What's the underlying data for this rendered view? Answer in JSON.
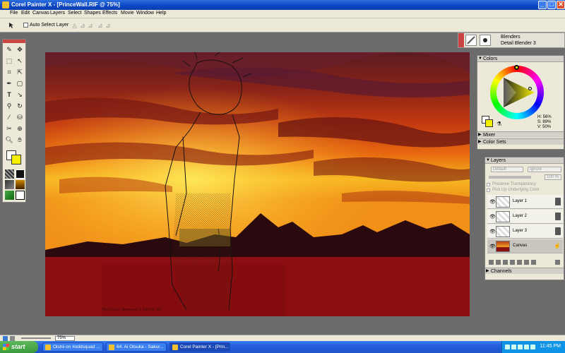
{
  "window": {
    "title": "Corel Painter X - [PrinceWall.RIF @ 75%]",
    "minimize": "_",
    "maximize": "□",
    "close": "✕"
  },
  "menu": [
    "File",
    "Edit",
    "Canvas",
    "Layers",
    "Select",
    "Shapes",
    "Effects",
    "Movie",
    "Window",
    "Help"
  ],
  "property_bar": {
    "auto_select_label": "Auto Select Layer",
    "auto_select_checked": false,
    "icons": [
      "arrow-pointer-icon",
      "align-icon",
      "transform-icon",
      "transform-icon",
      "transform-icon"
    ]
  },
  "brush_selector": {
    "category": "Blenders",
    "variant": "Detail Blender 3"
  },
  "toolbox": {
    "tools": [
      "brush-icon",
      "layer-adjuster-icon",
      "rectangular-selection-icon",
      "lasso-icon",
      "crop-icon",
      "transform-icon",
      "pen-icon",
      "rectangle-shape-icon",
      "text-icon",
      "shape-selection-icon",
      "magnifier-icon",
      "rotate-page-icon",
      "dropper-icon",
      "paint-bucket-icon",
      "eraser-icon",
      "cloner-icon",
      "magnifier-icon",
      "grabber-icon"
    ],
    "primary_color": "#f4f000",
    "secondary_color": "#ffffff"
  },
  "colors_panel": {
    "title": "Colors",
    "hue": "H: 56%",
    "saturation": "S: 89%",
    "value": "V: 50%",
    "sections": [
      "Mixer",
      "Color Sets"
    ]
  },
  "layers_panel": {
    "title": "Layers",
    "composite_method": "Default",
    "composite_depth": "Ignore",
    "opacity": "100 %",
    "preserve_transparency": "Preserve Transparency",
    "pick_up_color": "Pick Up Underlying Color",
    "layers": [
      {
        "name": "Layer 1",
        "visible": true,
        "selected": false
      },
      {
        "name": "Layer 2",
        "visible": true,
        "selected": false
      },
      {
        "name": "Layer 3",
        "visible": true,
        "selected": false
      },
      {
        "name": "Canvas",
        "visible": true,
        "selected": true
      }
    ],
    "channels": "Channels"
  },
  "status_bar": {
    "zoom": "75%"
  },
  "taskbar": {
    "start": "start",
    "tasks": [
      {
        "label": "Oishii on #oddsquad ...",
        "active": false
      },
      {
        "label": "64. Ai Otsuka - Sakur...",
        "active": false
      },
      {
        "label": "Corel Painter X - [Prin...",
        "active": true
      }
    ],
    "clock": "11:45 PM"
  },
  "canvas": {
    "signature": "Tokyo Corp. Mnemonic © 2007 Rt. Mt."
  }
}
